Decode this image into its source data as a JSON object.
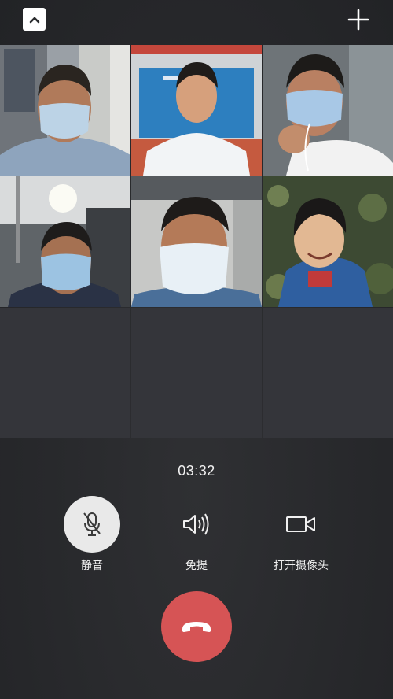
{
  "top_bar": {
    "collapse_icon": "chevron-up-icon",
    "add_icon": "plus-icon"
  },
  "participants": [
    {
      "id": "participant-1",
      "description": "man with mask and earphones"
    },
    {
      "id": "participant-2",
      "description": "man in white shirt in front of blue screen"
    },
    {
      "id": "participant-3",
      "description": "man in mask holding cord"
    },
    {
      "id": "participant-4",
      "description": "man with mask in dormitory"
    },
    {
      "id": "participant-5",
      "description": "man with mask facing camera"
    },
    {
      "id": "participant-6",
      "description": "smiling child"
    }
  ],
  "call": {
    "duration": "03:32"
  },
  "controls": {
    "mute_label": "静音",
    "speaker_label": "免提",
    "camera_label": "打开摄像头",
    "mute_icon": "mic-off-icon",
    "speaker_icon": "speaker-icon",
    "camera_icon": "video-camera-icon",
    "hangup_icon": "hang-up-icon"
  },
  "colors": {
    "hangup": "#d65455",
    "mute_active_bg": "#e9e9e9",
    "empty_tile": "#34353a"
  }
}
